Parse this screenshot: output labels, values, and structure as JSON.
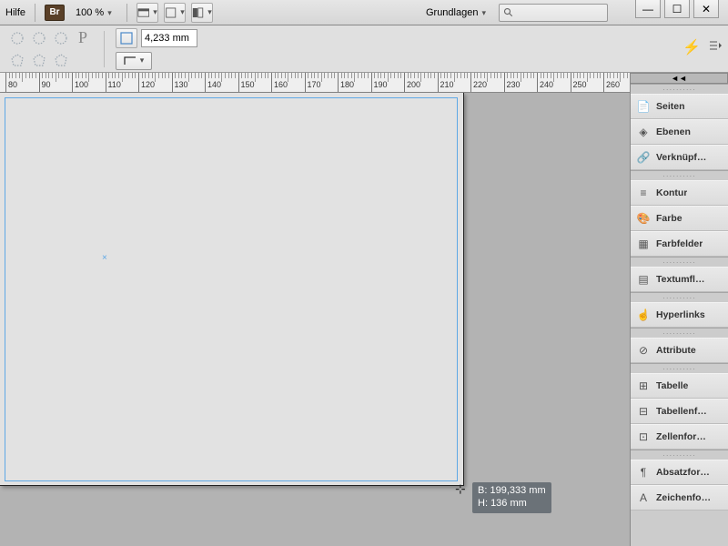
{
  "titlebar": {
    "help_label": "Hilfe",
    "bridge_badge": "Br",
    "zoom": "100 %",
    "workspace": "Grundlagen"
  },
  "options": {
    "dimension_value": "4,233 mm"
  },
  "ruler": {
    "ticks": [
      80,
      90,
      100,
      110,
      120,
      130,
      140,
      150,
      160,
      170,
      180,
      190,
      200,
      210,
      220,
      230,
      240,
      250,
      260
    ]
  },
  "tooltip": {
    "width_label": "B:",
    "width_value": "199,333 mm",
    "height_label": "H:",
    "height_value": "136 mm"
  },
  "panels": [
    {
      "group": [
        {
          "icon": "pages-icon",
          "label": "Seiten"
        },
        {
          "icon": "layers-icon",
          "label": "Ebenen"
        },
        {
          "icon": "links-icon",
          "label": "Verknüpf…"
        }
      ]
    },
    {
      "group": [
        {
          "icon": "stroke-icon",
          "label": "Kontur"
        },
        {
          "icon": "color-icon",
          "label": "Farbe"
        },
        {
          "icon": "swatches-icon",
          "label": "Farbfelder"
        }
      ]
    },
    {
      "group": [
        {
          "icon": "textwrap-icon",
          "label": "Textumfl…"
        }
      ]
    },
    {
      "group": [
        {
          "icon": "hyperlinks-icon",
          "label": "Hyperlinks"
        }
      ]
    },
    {
      "group": [
        {
          "icon": "attributes-icon",
          "label": "Attribute"
        }
      ]
    },
    {
      "group": [
        {
          "icon": "table-icon",
          "label": "Tabelle"
        },
        {
          "icon": "tablefmt-icon",
          "label": "Tabellenf…"
        },
        {
          "icon": "cellfmt-icon",
          "label": "Zellenfor…"
        }
      ]
    },
    {
      "group": [
        {
          "icon": "parafmt-icon",
          "label": "Absatzfor…"
        },
        {
          "icon": "charfmt-icon",
          "label": "Zeichenfo…"
        }
      ]
    }
  ]
}
